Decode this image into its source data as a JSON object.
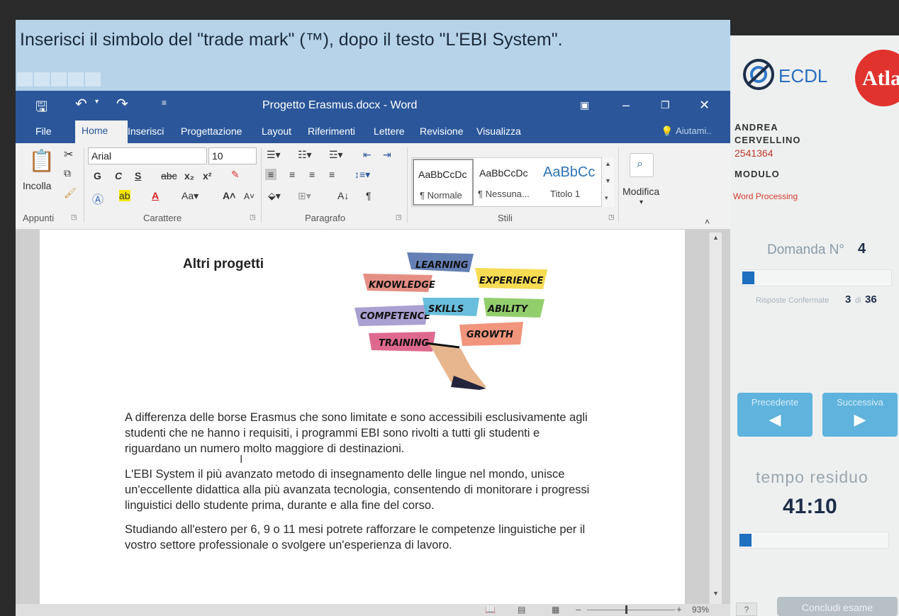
{
  "question": {
    "text": "Inserisci il simbolo del \"trade mark\" (™), dopo il testo \"L'EBI System\"."
  },
  "word": {
    "title": "Progetto Erasmus.docx - Word",
    "tabs": [
      "File",
      "Home",
      "Inserisci",
      "Progettazione",
      "Layout",
      "Riferimenti",
      "Lettere",
      "Revisione",
      "Visualizza"
    ],
    "tell_me": "Aiutami..",
    "clipboard": {
      "paste_label": "Incolla",
      "group_label": "Appunti"
    },
    "font": {
      "name": "Arial",
      "size": "10",
      "group_label": "Carattere"
    },
    "paragraph": {
      "group_label": "Paragrafo"
    },
    "styles": {
      "group_label": "Stili",
      "items": [
        {
          "preview": "AaBbCcDc",
          "name": "¶ Normale"
        },
        {
          "preview": "AaBbCcDc",
          "name": "¶ Nessuna..."
        },
        {
          "preview": "AaBbCc",
          "name": "Titolo 1"
        }
      ]
    },
    "edit": {
      "label": "Modifica"
    },
    "doc": {
      "heading": "Altri progetti",
      "image_words": [
        "LEARNING",
        "KNOWLEDGE",
        "EXPERIENCE",
        "COMPETENCE",
        "SKILLS",
        "ABILITY",
        "TRAINING",
        "GROWTH"
      ],
      "paragraphs": [
        [
          "A differenza delle borse Erasmus che sono limitate e sono accessibili esclusivamente agli",
          "studenti che ne hanno i requisiti, i programmi EBI sono rivolti a tutti gli studenti e",
          "riguardano un numero molto maggiore di destinazioni."
        ],
        [
          "L'EBI System  il più avanzato metodo di insegnamento delle lingue nel mondo, unisce",
          "un'eccellente didattica alla più avanzata tecnologia, consentendo di monitorare i progressi",
          "linguistici dello studente prima, durante e alla fine del corso."
        ],
        [
          "Studiando all'estero per 6, 9 o 11 mesi potrete rafforzare le competenze linguistiche per il",
          "vostro settore professionale o svolgere un'esperienza di lavoro."
        ]
      ]
    },
    "zoom": "93%"
  },
  "panel": {
    "brand": "ECDL",
    "partner_logo": "Atla",
    "first_name": "ANDREA",
    "last_name": "CERVELLINO",
    "id": "2541364",
    "module_label": "MODULO",
    "module_value": "Word Processing",
    "question_label": "Domanda N°",
    "question_number": "4",
    "question_progress": 0.08,
    "confirmed_label": "Risposte Confermate",
    "confirmed_count": "3",
    "of_label": "di",
    "total": "36",
    "prev_label": "Precedente",
    "next_label": "Successiva",
    "time_label": "tempo residuo",
    "time_value": "41:10",
    "time_progress": 0.08,
    "help_label": "?",
    "finish_label": "Concludi esame"
  },
  "colors": {
    "word_blue": "#2b579a",
    "question_bg": "#b6d3ea",
    "panel_bg": "#eef0f0",
    "progress_blue": "#1e6fc0",
    "nav_button": "#5fb3dd",
    "atlas_red": "#e0332e"
  }
}
